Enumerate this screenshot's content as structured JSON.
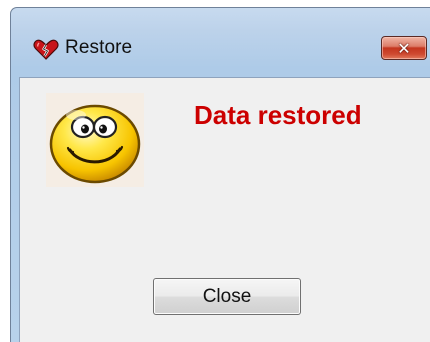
{
  "window": {
    "title": "Restore",
    "icon": "broken-heart-icon",
    "close_glyph": "✕"
  },
  "dialog": {
    "image": "smiley-face-icon",
    "message": "Data restored",
    "message_color": "#cc0000",
    "close_button_label": "Close"
  }
}
